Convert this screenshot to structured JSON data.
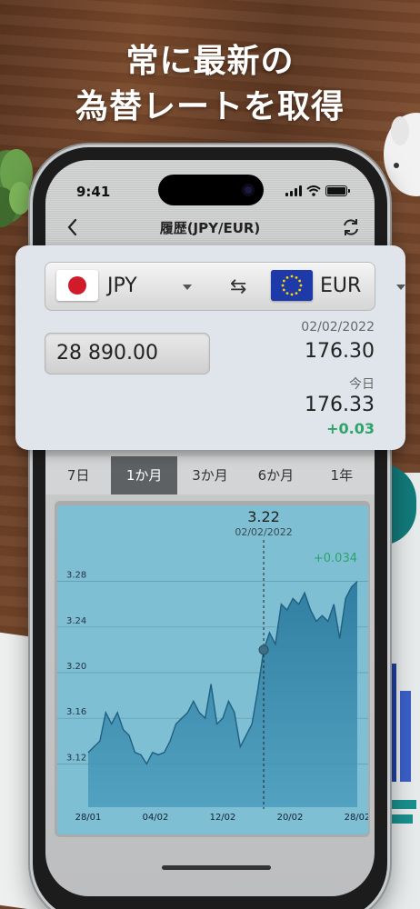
{
  "promo": {
    "line1": "常に最新の",
    "line2": "為替レートを取得"
  },
  "status": {
    "time": "9:41"
  },
  "nav": {
    "title": "履歴(JPY/EUR)"
  },
  "converter": {
    "from_code": "JPY",
    "to_code": "EUR",
    "amount": "28 890.00",
    "rate_date": "02/02/2022",
    "rate_value": "176.30",
    "today_label": "今日",
    "today_value": "176.33",
    "today_change": "+0.03"
  },
  "tabs": [
    {
      "label": "7日",
      "active": false
    },
    {
      "label": "1か月",
      "active": true
    },
    {
      "label": "3か月",
      "active": false
    },
    {
      "label": "6か月",
      "active": false
    },
    {
      "label": "1年",
      "active": false
    }
  ],
  "colors": {
    "accent_green": "#2ea36a",
    "chart_fill": "#2f7fa3",
    "chart_bg": "#7fbfd3",
    "active_tab": "#5e6163"
  },
  "chart_data": {
    "type": "area",
    "title": "",
    "selected_value": "3.22",
    "selected_date": "02/02/2022",
    "change_label": "+0.034",
    "x_tick_labels": [
      "28/01",
      "04/02",
      "12/02",
      "20/02",
      "28/02"
    ],
    "y_tick_labels": [
      "3.28",
      "3.24",
      "3.20",
      "3.16",
      "3.12"
    ],
    "y_ticks": [
      3.28,
      3.24,
      3.2,
      3.16,
      3.12
    ],
    "ylim": [
      3.09,
      3.31
    ],
    "x_count": 47,
    "selected_index": 30,
    "values": [
      3.13,
      3.135,
      3.14,
      3.165,
      3.155,
      3.165,
      3.15,
      3.145,
      3.13,
      3.128,
      3.12,
      3.13,
      3.128,
      3.13,
      3.14,
      3.155,
      3.16,
      3.165,
      3.175,
      3.165,
      3.16,
      3.19,
      3.155,
      3.16,
      3.175,
      3.165,
      3.135,
      3.145,
      3.155,
      3.185,
      3.22,
      3.235,
      3.225,
      3.26,
      3.255,
      3.265,
      3.26,
      3.27,
      3.255,
      3.245,
      3.25,
      3.245,
      3.26,
      3.23,
      3.265,
      3.275,
      3.28
    ],
    "grid": true
  }
}
